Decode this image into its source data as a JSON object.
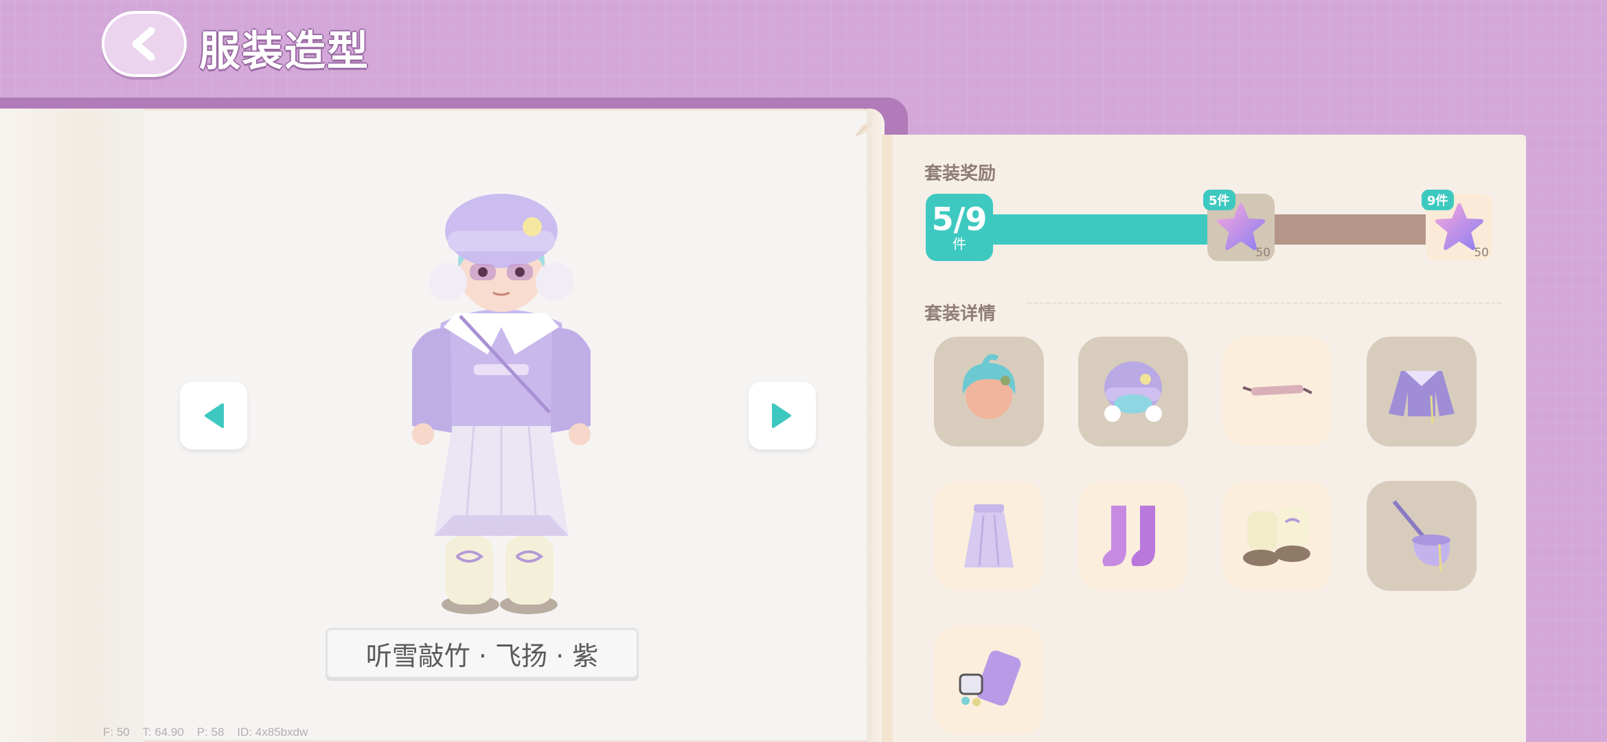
{
  "header": {
    "title": "服装造型"
  },
  "outfit": {
    "name": "听雪敲竹 · 飞扬 · 紫"
  },
  "debug": {
    "text": "F: 50    T: 64.90    P: 58    ID: 4x85bxdw"
  },
  "rewards": {
    "section_title": "套装奖励",
    "progress": {
      "current": 5,
      "total": 9,
      "counter_text": "5/9",
      "unit": "件",
      "fraction": 0.556
    },
    "tiers": [
      {
        "badge": "5件",
        "qty": "50",
        "icon": "star-pillow-icon"
      },
      {
        "badge": "9件",
        "qty": "50",
        "icon": "star-pillow-icon"
      }
    ]
  },
  "details": {
    "section_title": "套装详情",
    "items": [
      {
        "icon": "hairstyle-icon",
        "owned": true
      },
      {
        "icon": "knit-hat-icon",
        "owned": true
      },
      {
        "icon": "glasses-icon",
        "owned": false
      },
      {
        "icon": "jacket-icon",
        "owned": true
      },
      {
        "icon": "skirt-icon",
        "owned": false
      },
      {
        "icon": "socks-icon",
        "owned": false
      },
      {
        "icon": "boots-icon",
        "owned": false
      },
      {
        "icon": "bag-icon",
        "owned": true
      },
      {
        "icon": "phone-accessory-icon",
        "owned": false
      }
    ]
  },
  "colors": {
    "background": "#d3a8d8",
    "accent": "#3ec9c0",
    "progress_track": "#b49588",
    "owned_tile": "#d8cdbd",
    "locked_tile": "#fbeedd"
  }
}
